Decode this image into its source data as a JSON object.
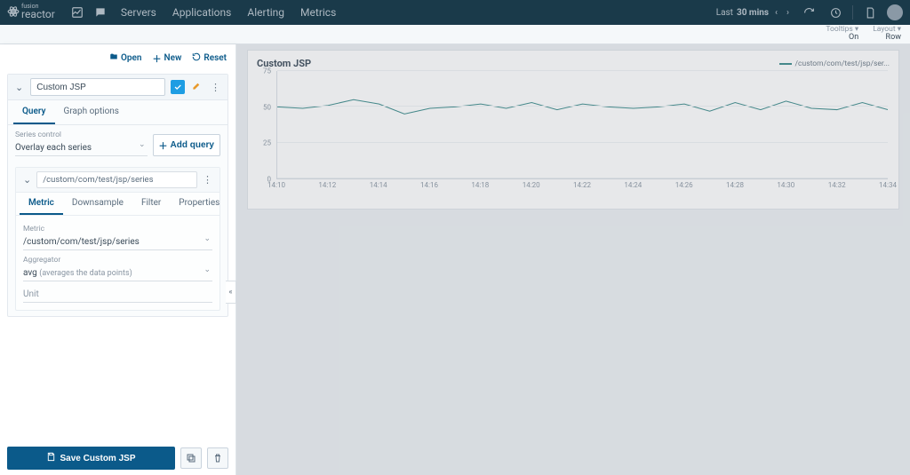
{
  "brand": "reactor",
  "brand_sub": "fusion",
  "nav": {
    "links": [
      "Servers",
      "Applications",
      "Alerting",
      "Metrics"
    ]
  },
  "time_range": {
    "prefix": "Last",
    "value": "30 mins"
  },
  "toolstrip": {
    "tooltips": {
      "label": "Tooltips ▾",
      "value": "On"
    },
    "layout": {
      "label": "Layout ▾",
      "value": "Row"
    }
  },
  "panel": {
    "actions": {
      "open": "Open",
      "new": "New",
      "reset": "Reset"
    },
    "dashboard_title": "Custom JSP",
    "tabs": {
      "query": "Query",
      "graph_options": "Graph options"
    },
    "series_control_label": "Series control",
    "series_control_value": "Overlay each series",
    "add_query": "Add query",
    "query": {
      "path": "/custom/com/test/jsp/series",
      "tabs": {
        "metric": "Metric",
        "downsample": "Downsample",
        "filter": "Filter",
        "properties": "Properties"
      },
      "metric_label": "Metric",
      "metric_value": "/custom/com/test/jsp/series",
      "aggregator_label": "Aggregator",
      "aggregator_value": "avg",
      "aggregator_paren": "(averages the data points)",
      "unit_label": "Unit"
    },
    "save": "Save Custom JSP"
  },
  "chart": {
    "title": "Custom JSP",
    "legend": "/custom/com/test/jsp/ser..."
  },
  "chart_data": {
    "type": "line",
    "series": [
      {
        "name": "/custom/com/test/jsp/series",
        "x": [
          "14:10",
          "14:11",
          "14:12",
          "14:13",
          "14:14",
          "14:15",
          "14:16",
          "14:17",
          "14:18",
          "14:19",
          "14:20",
          "14:21",
          "14:22",
          "14:23",
          "14:24",
          "14:25",
          "14:26",
          "14:27",
          "14:28",
          "14:29",
          "14:30",
          "14:31",
          "14:32",
          "14:33",
          "14:34"
        ],
        "values": [
          50,
          49,
          51,
          55,
          52,
          45,
          49,
          50,
          52,
          49,
          53,
          48,
          52,
          50,
          49,
          50,
          52,
          47,
          53,
          48,
          54,
          49,
          48,
          53,
          48
        ]
      }
    ],
    "x_ticks": [
      "14:10",
      "14:12",
      "14:14",
      "14:16",
      "14:18",
      "14:20",
      "14:22",
      "14:24",
      "14:26",
      "14:28",
      "14:30",
      "14:32",
      "14:34"
    ],
    "y_ticks": [
      0,
      25,
      50,
      75
    ],
    "ylim": [
      0,
      75
    ],
    "color": "#3a8a8a"
  }
}
